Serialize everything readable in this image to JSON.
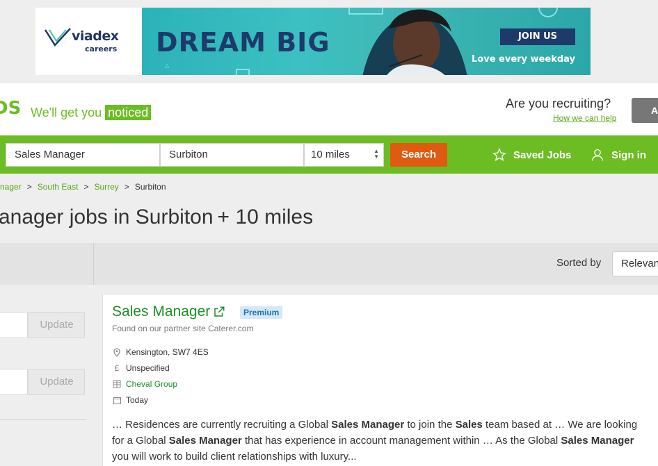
{
  "ad": {
    "brand": "viadex",
    "brand_sub": "careers",
    "headline": "DREAM BIG",
    "cta": "JOIN US",
    "tagline": "Love every weekday",
    "colors": {
      "teal": "#3cc0c2",
      "navy": "#1e3a6b"
    }
  },
  "header": {
    "logo_fragment": "DS",
    "tagline_pre": "We'll get you",
    "tagline_highlight": "noticed",
    "recruit_question": "Are you recruiting?",
    "recruit_help_link": "How we can help",
    "recruit_button": "A",
    "brand_color": "#6cbd24"
  },
  "search": {
    "keywords": "Sales Manager",
    "location": "Surbiton",
    "radius": "10 miles",
    "button": "Search",
    "saved_jobs": "Saved Jobs",
    "sign_in": "Sign in",
    "button_color": "#e05a11"
  },
  "breadcrumb": {
    "items": [
      "nager",
      "South East",
      "Surrey",
      "Surbiton"
    ],
    "separator": ">"
  },
  "page_title": "anager jobs in Surbiton + 10 miles",
  "toolbar": {
    "sorted_by_label": "Sorted by",
    "sort_value": "Relevance"
  },
  "filters": {
    "update_label": "Update"
  },
  "job": {
    "title": "Sales Manager",
    "badge": "Premium",
    "partner_note": "Found on our partner site Caterer.com",
    "location": "Kensington, SW7 4ES",
    "salary": "Unspecified",
    "company": "Cheval Group",
    "posted": "Today",
    "snippet": [
      {
        "t": "… Residences are currently recruiting a Global ",
        "b": false
      },
      {
        "t": "Sales Manager",
        "b": true
      },
      {
        "t": " to join the ",
        "b": false
      },
      {
        "t": "Sales",
        "b": true
      },
      {
        "t": " team based at … We are looking for a Global ",
        "b": false
      },
      {
        "t": "Sales Manager",
        "b": true
      },
      {
        "t": " that has experience in account management within … As the Global ",
        "b": false
      },
      {
        "t": "Sales Manager",
        "b": true
      },
      {
        "t": " you will work to build client relationships with luxury...",
        "b": false
      }
    ]
  },
  "icons": {
    "saved": "star-icon",
    "sign_in": "user-icon",
    "external": "external-link-icon",
    "location": "map-pin-icon",
    "salary": "pound-icon",
    "company": "building-icon",
    "posted": "calendar-icon"
  }
}
